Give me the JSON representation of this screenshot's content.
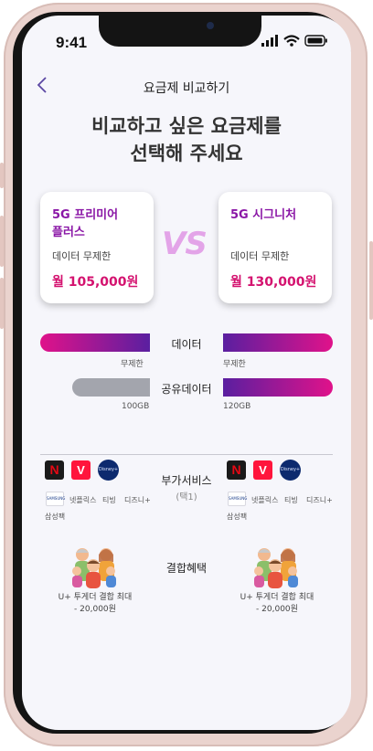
{
  "status_bar": {
    "time": "9:41"
  },
  "header": {
    "title": "요금제 비교하기"
  },
  "headline": {
    "line1": "비교하고 싶은 요금제를",
    "line2": "선택해 주세요"
  },
  "vs_label": "VS",
  "plans": [
    {
      "name_line1": "5G 프리미어",
      "name_line2": "플러스",
      "data_label": "데이터 무제한",
      "price": "월 105,000원",
      "data_value": "무제한",
      "shared_value": "100GB"
    },
    {
      "name_line1": "5G 시그니처",
      "name_line2": "",
      "data_label": "데이터 무제한",
      "price": "월 130,000원",
      "data_value": "무제한",
      "shared_value": "120GB"
    }
  ],
  "compare": {
    "data_label": "데이터",
    "shared_label": "공유데이터",
    "addon_label": "부가서비스",
    "addon_sub": "(택1)",
    "combo_label": "결합혜택"
  },
  "addons": {
    "items": [
      "넷플릭스",
      "티빙",
      "디즈니+",
      "삼성팩"
    ],
    "logos": [
      "N",
      "V",
      "Disney+",
      "SAMSUNG"
    ]
  },
  "combo": {
    "line1": "U+ 투게더 결합 최대",
    "line2": "- 20,000원"
  },
  "colors": {
    "accent_purple": "#8a16a6",
    "price_pink": "#d4126f",
    "bar_start": "#e0128a",
    "bar_end": "#5a1fa0",
    "bar_gray": "#a3a5ad"
  }
}
